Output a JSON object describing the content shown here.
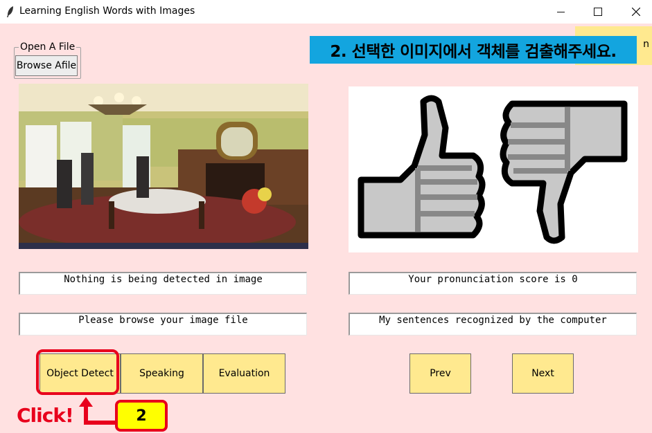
{
  "window": {
    "title": "Learning English Words with Images"
  },
  "banner": {
    "text": "2. 선택한 이미지에서 객체를 검출해주세요."
  },
  "corner_button": {
    "label": "n"
  },
  "file_group": {
    "label": "Open A File",
    "browse_label": "Browse Afile"
  },
  "status": {
    "detection": "Nothing is being detected in image",
    "browse_hint": "Please browse your image file",
    "pronunciation": "Your pronunciation score is 0",
    "recognized": "My sentences recognized by the computer"
  },
  "buttons": {
    "object_detect": "Object Detect",
    "speaking": "Speaking",
    "evaluation": "Evaluation",
    "prev": "Prev",
    "next": "Next"
  },
  "annotation": {
    "click_label": "Click!",
    "step_number": "2"
  },
  "colors": {
    "background": "#ffe1e1",
    "button_yellow": "#ffe98f",
    "banner_blue": "#13a5df",
    "highlight_red": "#e8001c"
  }
}
